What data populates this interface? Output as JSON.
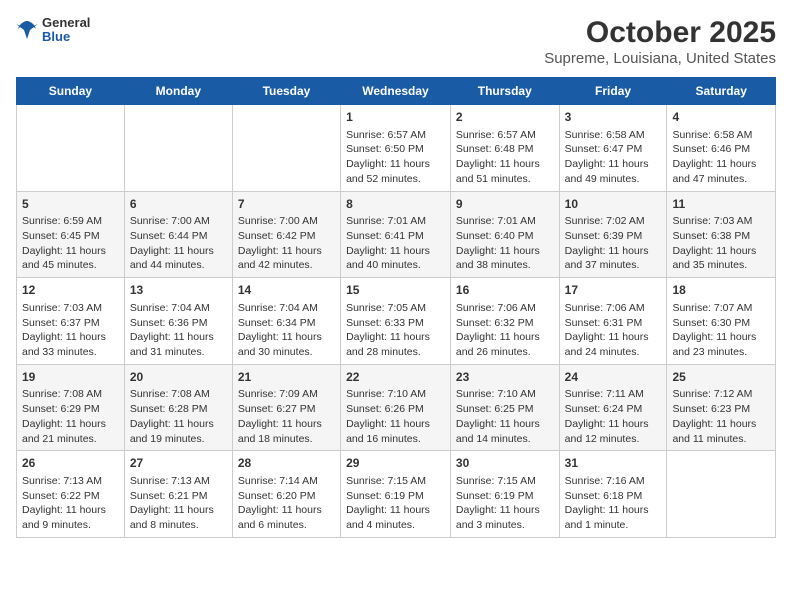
{
  "header": {
    "logo_general": "General",
    "logo_blue": "Blue",
    "title": "October 2025",
    "subtitle": "Supreme, Louisiana, United States"
  },
  "calendar": {
    "days_of_week": [
      "Sunday",
      "Monday",
      "Tuesday",
      "Wednesday",
      "Thursday",
      "Friday",
      "Saturday"
    ],
    "weeks": [
      [
        {
          "day": "",
          "text": ""
        },
        {
          "day": "",
          "text": ""
        },
        {
          "day": "",
          "text": ""
        },
        {
          "day": "1",
          "text": "Sunrise: 6:57 AM\nSunset: 6:50 PM\nDaylight: 11 hours\nand 52 minutes."
        },
        {
          "day": "2",
          "text": "Sunrise: 6:57 AM\nSunset: 6:48 PM\nDaylight: 11 hours\nand 51 minutes."
        },
        {
          "day": "3",
          "text": "Sunrise: 6:58 AM\nSunset: 6:47 PM\nDaylight: 11 hours\nand 49 minutes."
        },
        {
          "day": "4",
          "text": "Sunrise: 6:58 AM\nSunset: 6:46 PM\nDaylight: 11 hours\nand 47 minutes."
        }
      ],
      [
        {
          "day": "5",
          "text": "Sunrise: 6:59 AM\nSunset: 6:45 PM\nDaylight: 11 hours\nand 45 minutes."
        },
        {
          "day": "6",
          "text": "Sunrise: 7:00 AM\nSunset: 6:44 PM\nDaylight: 11 hours\nand 44 minutes."
        },
        {
          "day": "7",
          "text": "Sunrise: 7:00 AM\nSunset: 6:42 PM\nDaylight: 11 hours\nand 42 minutes."
        },
        {
          "day": "8",
          "text": "Sunrise: 7:01 AM\nSunset: 6:41 PM\nDaylight: 11 hours\nand 40 minutes."
        },
        {
          "day": "9",
          "text": "Sunrise: 7:01 AM\nSunset: 6:40 PM\nDaylight: 11 hours\nand 38 minutes."
        },
        {
          "day": "10",
          "text": "Sunrise: 7:02 AM\nSunset: 6:39 PM\nDaylight: 11 hours\nand 37 minutes."
        },
        {
          "day": "11",
          "text": "Sunrise: 7:03 AM\nSunset: 6:38 PM\nDaylight: 11 hours\nand 35 minutes."
        }
      ],
      [
        {
          "day": "12",
          "text": "Sunrise: 7:03 AM\nSunset: 6:37 PM\nDaylight: 11 hours\nand 33 minutes."
        },
        {
          "day": "13",
          "text": "Sunrise: 7:04 AM\nSunset: 6:36 PM\nDaylight: 11 hours\nand 31 minutes."
        },
        {
          "day": "14",
          "text": "Sunrise: 7:04 AM\nSunset: 6:34 PM\nDaylight: 11 hours\nand 30 minutes."
        },
        {
          "day": "15",
          "text": "Sunrise: 7:05 AM\nSunset: 6:33 PM\nDaylight: 11 hours\nand 28 minutes."
        },
        {
          "day": "16",
          "text": "Sunrise: 7:06 AM\nSunset: 6:32 PM\nDaylight: 11 hours\nand 26 minutes."
        },
        {
          "day": "17",
          "text": "Sunrise: 7:06 AM\nSunset: 6:31 PM\nDaylight: 11 hours\nand 24 minutes."
        },
        {
          "day": "18",
          "text": "Sunrise: 7:07 AM\nSunset: 6:30 PM\nDaylight: 11 hours\nand 23 minutes."
        }
      ],
      [
        {
          "day": "19",
          "text": "Sunrise: 7:08 AM\nSunset: 6:29 PM\nDaylight: 11 hours\nand 21 minutes."
        },
        {
          "day": "20",
          "text": "Sunrise: 7:08 AM\nSunset: 6:28 PM\nDaylight: 11 hours\nand 19 minutes."
        },
        {
          "day": "21",
          "text": "Sunrise: 7:09 AM\nSunset: 6:27 PM\nDaylight: 11 hours\nand 18 minutes."
        },
        {
          "day": "22",
          "text": "Sunrise: 7:10 AM\nSunset: 6:26 PM\nDaylight: 11 hours\nand 16 minutes."
        },
        {
          "day": "23",
          "text": "Sunrise: 7:10 AM\nSunset: 6:25 PM\nDaylight: 11 hours\nand 14 minutes."
        },
        {
          "day": "24",
          "text": "Sunrise: 7:11 AM\nSunset: 6:24 PM\nDaylight: 11 hours\nand 12 minutes."
        },
        {
          "day": "25",
          "text": "Sunrise: 7:12 AM\nSunset: 6:23 PM\nDaylight: 11 hours\nand 11 minutes."
        }
      ],
      [
        {
          "day": "26",
          "text": "Sunrise: 7:13 AM\nSunset: 6:22 PM\nDaylight: 11 hours\nand 9 minutes."
        },
        {
          "day": "27",
          "text": "Sunrise: 7:13 AM\nSunset: 6:21 PM\nDaylight: 11 hours\nand 8 minutes."
        },
        {
          "day": "28",
          "text": "Sunrise: 7:14 AM\nSunset: 6:20 PM\nDaylight: 11 hours\nand 6 minutes."
        },
        {
          "day": "29",
          "text": "Sunrise: 7:15 AM\nSunset: 6:19 PM\nDaylight: 11 hours\nand 4 minutes."
        },
        {
          "day": "30",
          "text": "Sunrise: 7:15 AM\nSunset: 6:19 PM\nDaylight: 11 hours\nand 3 minutes."
        },
        {
          "day": "31",
          "text": "Sunrise: 7:16 AM\nSunset: 6:18 PM\nDaylight: 11 hours\nand 1 minute."
        },
        {
          "day": "",
          "text": ""
        }
      ]
    ]
  }
}
